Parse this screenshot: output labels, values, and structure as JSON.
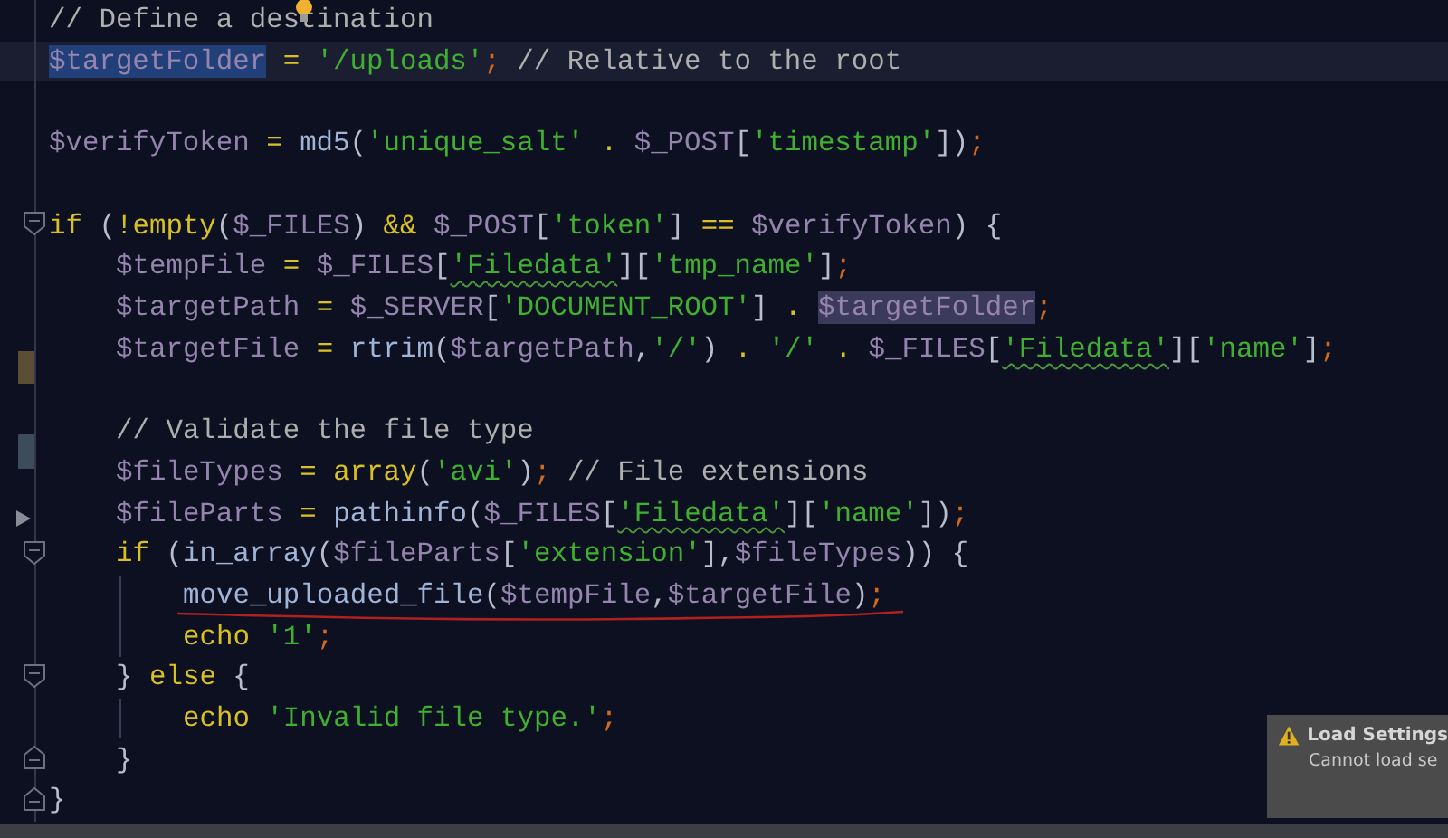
{
  "editor": {
    "lines": [
      {
        "kind": "code",
        "bulb": true,
        "tokens": [
          {
            "kind": "comment",
            "text": "// Define a destination"
          }
        ]
      },
      {
        "kind": "code",
        "current": true,
        "tokens": [
          {
            "kind": "var",
            "text": "$targetFolder",
            "selected": true
          },
          {
            "kind": "op",
            "text": " = "
          },
          {
            "kind": "str",
            "text": "'/uploads'"
          },
          {
            "kind": "semi",
            "text": ";"
          },
          {
            "kind": "comment",
            "text": " // Relative to the root"
          }
        ]
      },
      {
        "kind": "blank"
      },
      {
        "kind": "code",
        "tokens": [
          {
            "kind": "var",
            "text": "$verifyToken"
          },
          {
            "kind": "op",
            "text": " = "
          },
          {
            "kind": "fn",
            "text": "md5"
          },
          {
            "kind": "punct",
            "text": "("
          },
          {
            "kind": "str",
            "text": "'unique_salt'"
          },
          {
            "kind": "op",
            "text": " . "
          },
          {
            "kind": "var",
            "text": "$_POST"
          },
          {
            "kind": "punct",
            "text": "["
          },
          {
            "kind": "str",
            "text": "'timestamp'"
          },
          {
            "kind": "punct",
            "text": "])"
          },
          {
            "kind": "semi",
            "text": ";"
          }
        ]
      },
      {
        "kind": "blank"
      },
      {
        "kind": "code",
        "fold_start": true,
        "tokens": [
          {
            "kind": "kw",
            "text": "if"
          },
          {
            "kind": "punct",
            "text": " ("
          },
          {
            "kind": "op",
            "text": "!"
          },
          {
            "kind": "kw",
            "text": "empty"
          },
          {
            "kind": "punct",
            "text": "("
          },
          {
            "kind": "var",
            "text": "$_FILES"
          },
          {
            "kind": "punct",
            "text": ")"
          },
          {
            "kind": "op",
            "text": " && "
          },
          {
            "kind": "var",
            "text": "$_POST"
          },
          {
            "kind": "punct",
            "text": "["
          },
          {
            "kind": "str",
            "text": "'token'"
          },
          {
            "kind": "punct",
            "text": "]"
          },
          {
            "kind": "op",
            "text": " == "
          },
          {
            "kind": "var",
            "text": "$verifyToken"
          },
          {
            "kind": "punct",
            "text": ") {"
          }
        ],
        "children": [
          {
            "kind": "code",
            "tokens": [
              {
                "kind": "var",
                "text": "$tempFile"
              },
              {
                "kind": "op",
                "text": " = "
              },
              {
                "kind": "var",
                "text": "$_FILES"
              },
              {
                "kind": "punct",
                "text": "["
              },
              {
                "kind": "str",
                "text": "'Filedata'",
                "squiggle": true
              },
              {
                "kind": "punct",
                "text": "]["
              },
              {
                "kind": "str",
                "text": "'tmp_name'"
              },
              {
                "kind": "punct",
                "text": "]"
              },
              {
                "kind": "semi",
                "text": ";"
              }
            ]
          },
          {
            "kind": "code",
            "tokens": [
              {
                "kind": "var",
                "text": "$targetPath"
              },
              {
                "kind": "op",
                "text": " = "
              },
              {
                "kind": "var",
                "text": "$_SERVER"
              },
              {
                "kind": "punct",
                "text": "["
              },
              {
                "kind": "str",
                "text": "'DOCUMENT_ROOT'"
              },
              {
                "kind": "punct",
                "text": "]"
              },
              {
                "kind": "op",
                "text": " . "
              },
              {
                "kind": "var",
                "text": "$targetFolder",
                "highlighted": true
              },
              {
                "kind": "semi",
                "text": ";"
              }
            ]
          },
          {
            "kind": "code",
            "tokens": [
              {
                "kind": "var",
                "text": "$targetFile"
              },
              {
                "kind": "op",
                "text": " = "
              },
              {
                "kind": "fn",
                "text": "rtrim"
              },
              {
                "kind": "punct",
                "text": "("
              },
              {
                "kind": "var",
                "text": "$targetPath"
              },
              {
                "kind": "punct",
                "text": ","
              },
              {
                "kind": "str",
                "text": "'/'"
              },
              {
                "kind": "punct",
                "text": ")"
              },
              {
                "kind": "op",
                "text": " . "
              },
              {
                "kind": "str",
                "text": "'/'"
              },
              {
                "kind": "op",
                "text": " . "
              },
              {
                "kind": "var",
                "text": "$_FILES"
              },
              {
                "kind": "punct",
                "text": "["
              },
              {
                "kind": "str",
                "text": "'Filedata'",
                "squiggle": true
              },
              {
                "kind": "punct",
                "text": "]["
              },
              {
                "kind": "str",
                "text": "'name'"
              },
              {
                "kind": "punct",
                "text": "]"
              },
              {
                "kind": "semi",
                "text": ";"
              }
            ]
          },
          {
            "kind": "blank",
            "modified_mark": true
          },
          {
            "kind": "code",
            "tokens": [
              {
                "kind": "comment",
                "text": "// Validate the file type"
              }
            ]
          },
          {
            "kind": "code",
            "added_mark": true,
            "tokens": [
              {
                "kind": "var",
                "text": "$fileTypes"
              },
              {
                "kind": "op",
                "text": " = "
              },
              {
                "kind": "kw",
                "text": "array"
              },
              {
                "kind": "punct",
                "text": "("
              },
              {
                "kind": "str",
                "text": "'avi'"
              },
              {
                "kind": "punct",
                "text": ")"
              },
              {
                "kind": "semi",
                "text": ";"
              },
              {
                "kind": "comment",
                "text": " // File extensions"
              }
            ]
          },
          {
            "kind": "code",
            "arrow_mark": true,
            "tokens": [
              {
                "kind": "var",
                "text": "$fileParts"
              },
              {
                "kind": "op",
                "text": " = "
              },
              {
                "kind": "fn",
                "text": "pathinfo"
              },
              {
                "kind": "punct",
                "text": "("
              },
              {
                "kind": "var",
                "text": "$_FILES"
              },
              {
                "kind": "punct",
                "text": "["
              },
              {
                "kind": "str",
                "text": "'Filedata'",
                "squiggle": true
              },
              {
                "kind": "punct",
                "text": "]["
              },
              {
                "kind": "str",
                "text": "'name'"
              },
              {
                "kind": "punct",
                "text": "])"
              },
              {
                "kind": "semi",
                "text": ";"
              }
            ]
          },
          {
            "kind": "code",
            "fold_start": true,
            "tokens": [
              {
                "kind": "kw",
                "text": "if"
              },
              {
                "kind": "punct",
                "text": " ("
              },
              {
                "kind": "fn",
                "text": "in_array"
              },
              {
                "kind": "punct",
                "text": "("
              },
              {
                "kind": "var",
                "text": "$fileParts"
              },
              {
                "kind": "punct",
                "text": "["
              },
              {
                "kind": "str",
                "text": "'extension'"
              },
              {
                "kind": "punct",
                "text": "],"
              },
              {
                "kind": "var",
                "text": "$fileTypes"
              },
              {
                "kind": "punct",
                "text": ")) {"
              }
            ],
            "children": [
              {
                "kind": "code",
                "annotated": true,
                "tokens": [
                  {
                    "kind": "fn",
                    "text": "move_uploaded_file"
                  },
                  {
                    "kind": "punct",
                    "text": "("
                  },
                  {
                    "kind": "var",
                    "text": "$tempFile"
                  },
                  {
                    "kind": "punct",
                    "text": ","
                  },
                  {
                    "kind": "var",
                    "text": "$targetFile"
                  },
                  {
                    "kind": "punct",
                    "text": ")"
                  },
                  {
                    "kind": "semi",
                    "text": ";"
                  }
                ]
              },
              {
                "kind": "code",
                "tokens": [
                  {
                    "kind": "kw",
                    "text": "echo "
                  },
                  {
                    "kind": "str",
                    "text": "'1'"
                  },
                  {
                    "kind": "semi",
                    "text": ";"
                  }
                ]
              }
            ]
          },
          {
            "kind": "code",
            "fold_start": true,
            "tokens": [
              {
                "kind": "punct",
                "text": "} "
              },
              {
                "kind": "kw",
                "text": "else"
              },
              {
                "kind": "punct",
                "text": " {"
              }
            ],
            "children": [
              {
                "kind": "code",
                "tokens": [
                  {
                    "kind": "kw",
                    "text": "echo "
                  },
                  {
                    "kind": "str",
                    "text": "'Invalid file type.'"
                  },
                  {
                    "kind": "semi",
                    "text": ";"
                  }
                ]
              }
            ]
          },
          {
            "kind": "code",
            "fold_end": true,
            "tokens": [
              {
                "kind": "punct",
                "text": "}"
              }
            ]
          }
        ]
      },
      {
        "kind": "code",
        "fold_end": true,
        "tokens": [
          {
            "kind": "punct",
            "text": "}"
          }
        ]
      }
    ]
  },
  "notification": {
    "title": "Load Settings",
    "message": "Cannot load se"
  }
}
